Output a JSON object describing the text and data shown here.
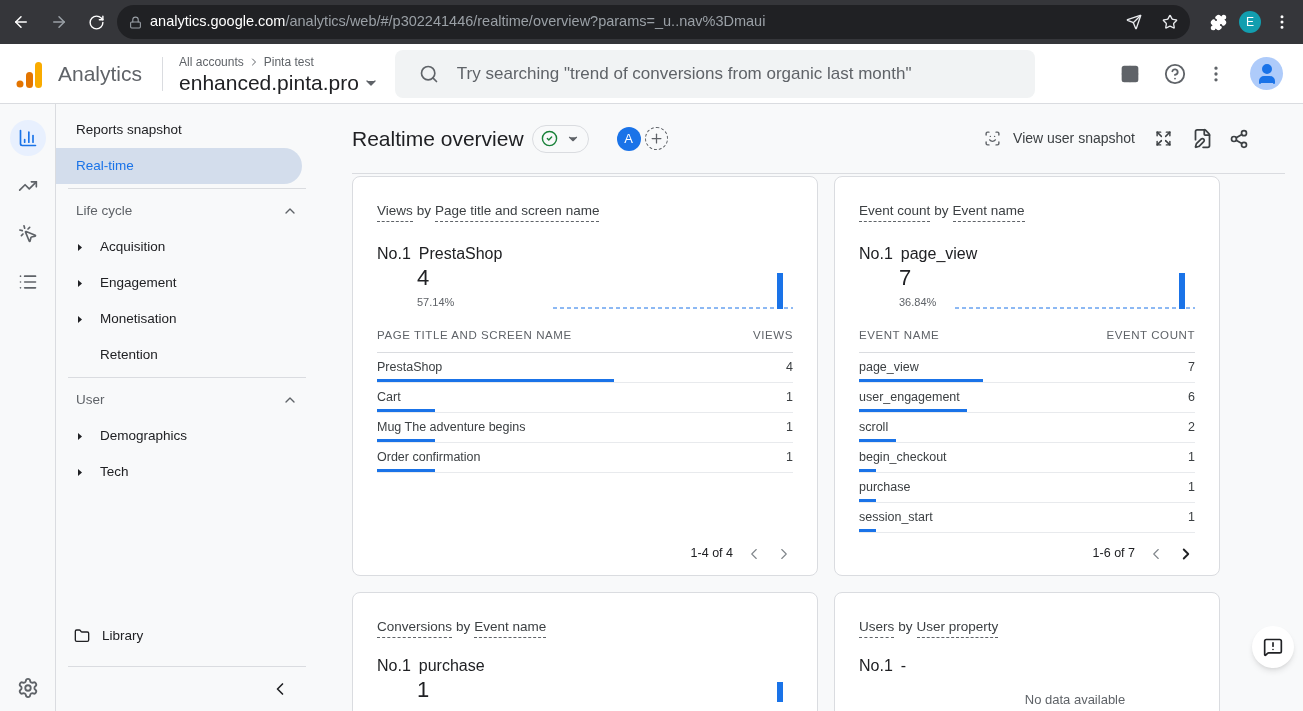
{
  "browser": {
    "url_host": "analytics.google.com",
    "url_path": "/analytics/web/#/p302241446/realtime/overview?params=_u..nav%3Dmaui",
    "profile": "E"
  },
  "header": {
    "product": "Analytics",
    "breadcrumb": [
      "All accounts",
      "Pinta test"
    ],
    "property": "enhanced.pinta.pro",
    "search": {
      "placeholder": "Try searching \"trend of conversions from organic last month\""
    }
  },
  "rail": [
    {
      "kind": "reports",
      "selected": true
    },
    {
      "kind": "explore",
      "selected": false
    },
    {
      "kind": "advertising",
      "selected": false
    },
    {
      "kind": "configure",
      "selected": false
    }
  ],
  "sidebar": {
    "top": [
      {
        "label": "Reports snapshot",
        "selected": false
      },
      {
        "label": "Real-time",
        "selected": true
      }
    ],
    "sections": [
      {
        "title": "Life cycle",
        "expanded": true,
        "items": [
          {
            "label": "Acquisition",
            "expandable": true
          },
          {
            "label": "Engagement",
            "expandable": true
          },
          {
            "label": "Monetisation",
            "expandable": true
          },
          {
            "label": "Retention",
            "expandable": false
          }
        ]
      },
      {
        "title": "User",
        "expanded": true,
        "items": [
          {
            "label": "Demographics",
            "expandable": true
          },
          {
            "label": "Tech",
            "expandable": true
          }
        ]
      }
    ],
    "library": "Library"
  },
  "page": {
    "title": "Realtime overview",
    "avatar": "A",
    "actions": [
      "View user snapshot"
    ]
  },
  "cards": [
    {
      "title_parts": [
        "Views",
        "by",
        "Page title and screen name"
      ],
      "top_label": "No.1",
      "top_name": "PrestaShop",
      "top_value": "4",
      "top_share": "57.14%",
      "columns": [
        "PAGE TITLE AND SCREEN NAME",
        "VIEWS"
      ],
      "rows": [
        {
          "name": "PrestaShop",
          "value": "4",
          "level": 0.57
        },
        {
          "name": "Cart",
          "value": "1",
          "level": 0.14
        },
        {
          "name": "Mug The adventure begins",
          "value": "1",
          "level": 0.14
        },
        {
          "name": "Order confirmation",
          "value": "1",
          "level": 0.14
        }
      ],
      "pagination": {
        "text": "1-4 of 4",
        "prev_disabled": true,
        "next_disabled": true
      }
    },
    {
      "title_parts": [
        "Event count",
        "by",
        "Event name"
      ],
      "top_label": "No.1",
      "top_name": "page_view",
      "top_value": "7",
      "top_share": "36.84%",
      "columns": [
        "EVENT NAME",
        "EVENT COUNT"
      ],
      "rows": [
        {
          "name": "page_view",
          "value": "7",
          "level": 0.37
        },
        {
          "name": "user_engagement",
          "value": "6",
          "level": 0.32
        },
        {
          "name": "scroll",
          "value": "2",
          "level": 0.11
        },
        {
          "name": "begin_checkout",
          "value": "1",
          "level": 0.05
        },
        {
          "name": "purchase",
          "value": "1",
          "level": 0.05
        },
        {
          "name": "session_start",
          "value": "1",
          "level": 0.05
        }
      ],
      "pagination": {
        "text": "1-6 of 7",
        "prev_disabled": true,
        "next_disabled": false
      }
    },
    {
      "title_parts": [
        "Conversions",
        "by",
        "Event name"
      ],
      "top_label": "No.1",
      "top_name": "purchase",
      "top_value": "1"
    },
    {
      "title_parts": [
        "Users",
        "by",
        "User property"
      ],
      "top_label": "No.1",
      "top_name": "-",
      "empty_text": "No data available"
    }
  ]
}
